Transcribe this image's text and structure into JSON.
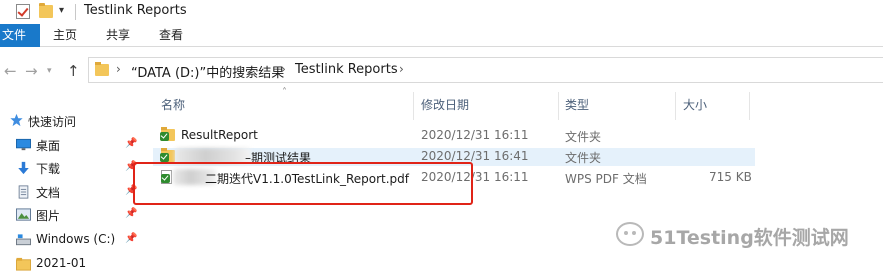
{
  "window": {
    "title": "Testlink Reports"
  },
  "ribbon": {
    "tabs": [
      "文件",
      "主页",
      "共享",
      "查看"
    ]
  },
  "address": {
    "crumbs": [
      "“DATA (D:)”中的搜索结果",
      "Testlink Reports"
    ]
  },
  "nav": {
    "items": [
      {
        "label": "快速访问",
        "icon": "star-icon",
        "pinned": false
      },
      {
        "label": "桌面",
        "icon": "desktop-icon",
        "pinned": true
      },
      {
        "label": "下载",
        "icon": "download-icon",
        "pinned": true
      },
      {
        "label": "文档",
        "icon": "document-icon",
        "pinned": true
      },
      {
        "label": "图片",
        "icon": "pictures-icon",
        "pinned": true
      },
      {
        "label": "Windows (C:)",
        "icon": "drive-icon",
        "pinned": true
      },
      {
        "label": "2021-01",
        "icon": "folder-icon",
        "pinned": false
      }
    ]
  },
  "columns": {
    "name": "名称",
    "date": "修改日期",
    "type": "类型",
    "size": "大小"
  },
  "files": [
    {
      "name": "ResultReport",
      "date": "2020/12/31 16:11",
      "type": "文件夹",
      "size": "",
      "icon": "folder-icon"
    },
    {
      "name": "–期测试结果",
      "date": "2020/12/31 16:41",
      "type": "文件夹",
      "size": "",
      "icon": "folder-icon"
    },
    {
      "name": "二期迭代V1.1.0TestLink_Report.pdf",
      "date": "2020/12/31 16:11",
      "type": "WPS PDF 文档",
      "size": "715 KB",
      "icon": "pdf-icon"
    }
  ],
  "watermark": {
    "text": "51Testing软件测试网"
  },
  "colors": {
    "accent": "#1979ca",
    "highlight": "#e02418",
    "selection": "#e5f1fb"
  }
}
